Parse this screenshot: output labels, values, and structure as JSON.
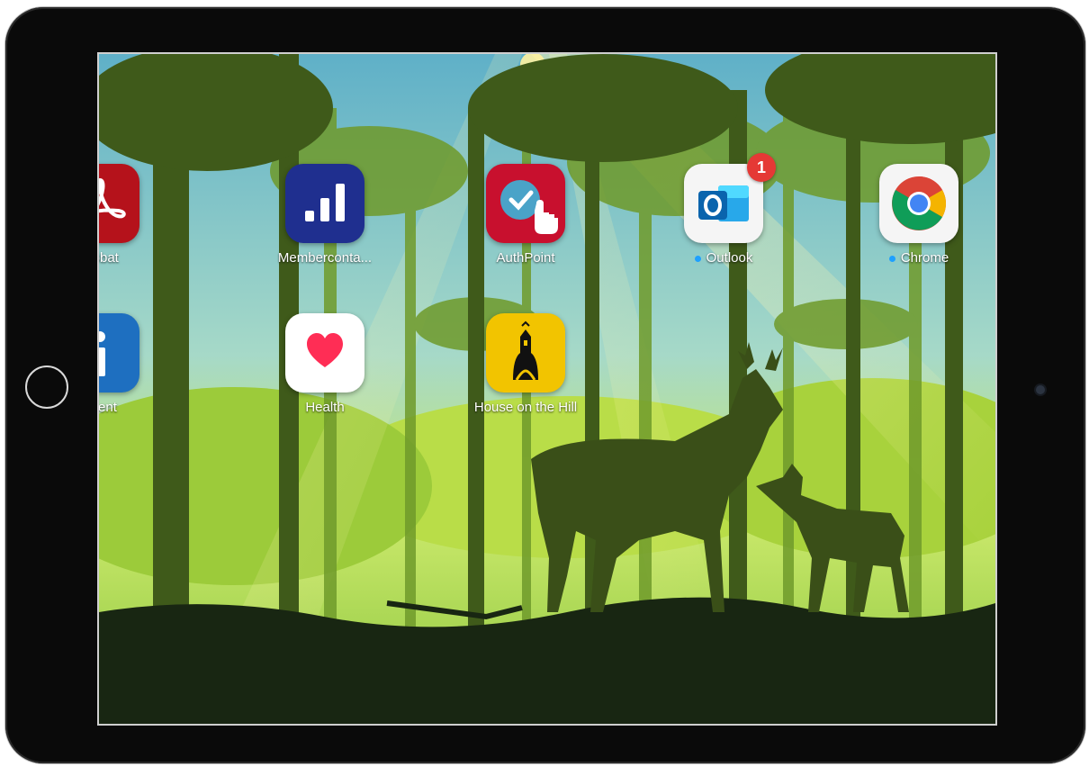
{
  "home_screen": {
    "apps": [
      {
        "label": "crobat",
        "icon": "acrobat-icon",
        "color": "#b5121b"
      },
      {
        "label": "Memberconta...",
        "icon": "bar-chart-icon",
        "color": "#1f2f8f"
      },
      {
        "label": "AuthPoint",
        "icon": "authpoint-icon",
        "color": "#c8102e"
      },
      {
        "label": "Outlook",
        "icon": "outlook-icon",
        "color": "#f5f5f5",
        "badge": "1",
        "dot_color": "#1ea0ff"
      },
      {
        "label": "Chrome",
        "icon": "chrome-icon",
        "color": "#f5f5f5",
        "dot_color": "#1ea0ff"
      },
      {
        "label": "iTrent",
        "icon": "info-icon",
        "color": "#1e6fc0"
      },
      {
        "label": "Health",
        "icon": "heart-icon",
        "color": "#ffffff"
      },
      {
        "label": "House on the Hill",
        "icon": "house-on-the-hill-icon",
        "color": "#f2c400"
      }
    ]
  },
  "wallpaper": {
    "theme": "forest-deer",
    "accent": "#b8d94a"
  }
}
